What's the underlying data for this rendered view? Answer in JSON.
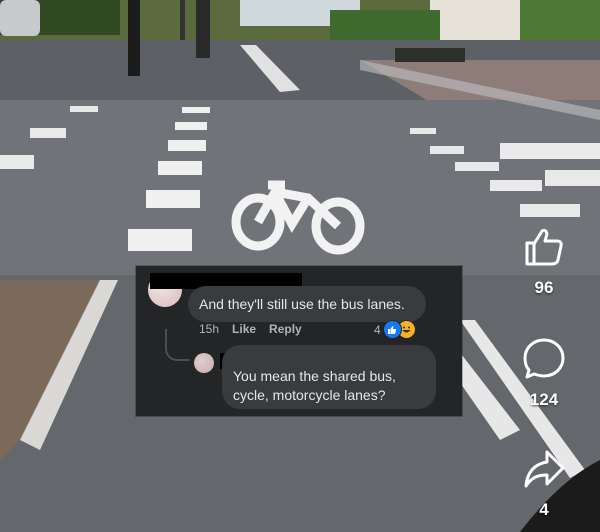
{
  "post": {
    "actions": {
      "like": {
        "icon": "thumbs-up-icon",
        "count": "96"
      },
      "comment": {
        "icon": "comment-bubble-icon",
        "count": "124"
      },
      "share": {
        "icon": "share-arrow-icon",
        "count": "4"
      }
    }
  },
  "comments": [
    {
      "text": "And they'll still use the bus lanes.",
      "time": "15h",
      "like_label": "Like",
      "reply_label": "Reply",
      "reaction_count": "4",
      "reactions": [
        "like",
        "haha"
      ]
    },
    {
      "text": "You mean the shared bus, cycle, motorcycle lanes?"
    }
  ],
  "colors": {
    "card_bg": "#242526",
    "bubble_bg": "#3a3b3c",
    "like_blue": "#1877f2",
    "haha_yellow": "#f7b125"
  }
}
